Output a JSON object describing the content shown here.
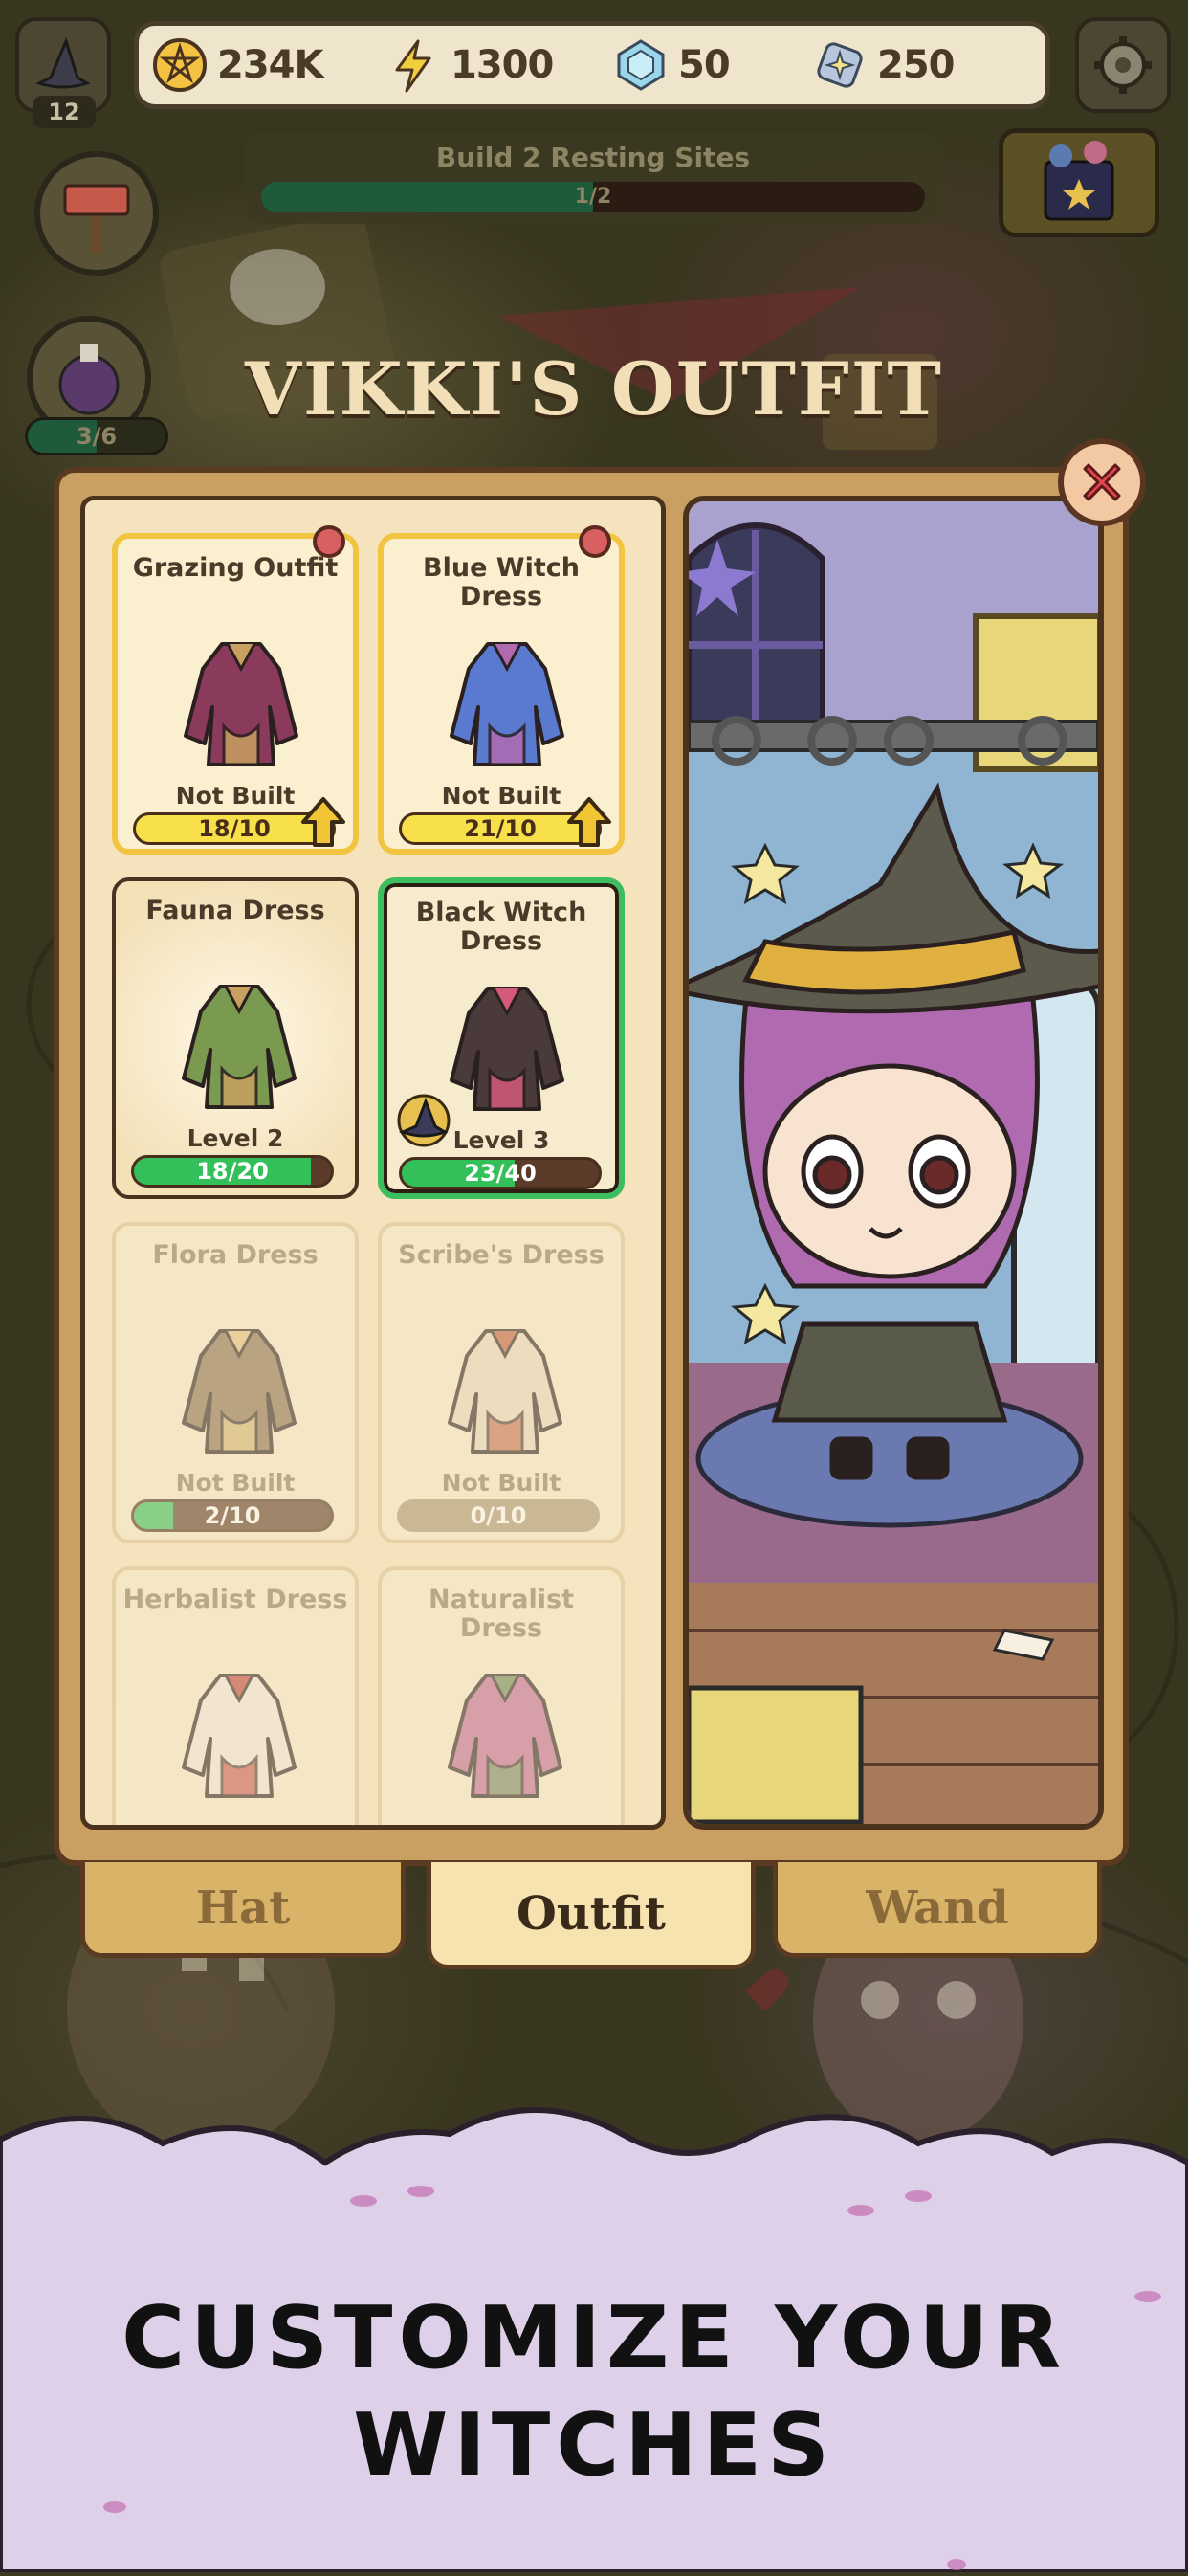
{
  "hud": {
    "gold": "234K",
    "energy": "1300",
    "gems": "50",
    "crystals": "250",
    "level": "12",
    "side_progress": "3/6",
    "side_progress_fraction": 0.5
  },
  "quest": {
    "title": "Build 2 Resting Sites",
    "progress": "1/2",
    "progress_fraction": 0.5
  },
  "panel": {
    "title": "VIKKI'S OUTFIT"
  },
  "outfits": [
    {
      "name": "Grazing Outfit",
      "status": "Not Built",
      "bar": "18/10",
      "fraction": 1.0,
      "state": "upgrade",
      "notify": true
    },
    {
      "name": "Blue Witch Dress",
      "status": "Not Built",
      "bar": "21/10",
      "fraction": 1.0,
      "state": "upgrade",
      "notify": true
    },
    {
      "name": "Fauna Dress",
      "status": "Level 2",
      "bar": "18/20",
      "fraction": 0.9,
      "state": "owned"
    },
    {
      "name": "Black Witch Dress",
      "status": "Level 3",
      "bar": "23/40",
      "fraction": 0.575,
      "state": "selected"
    },
    {
      "name": "Flora Dress",
      "status": "Not Built",
      "bar": "2/10",
      "fraction": 0.2,
      "state": "locked"
    },
    {
      "name": "Scribe's Dress",
      "status": "Not Built",
      "bar": "0/10",
      "fraction": 0.0,
      "state": "locked"
    },
    {
      "name": "Herbalist Dress",
      "state": "locked"
    },
    {
      "name": "Naturalist Dress",
      "state": "locked"
    }
  ],
  "tabs": {
    "hat": "Hat",
    "outfit": "Outfit",
    "wand": "Wand"
  },
  "promo": {
    "line1": "CUSTOMIZE YOUR",
    "line2": "WITCHES"
  },
  "colors": {
    "progress_green": "#33c05a",
    "upgrade_yellow": "#f7e04a",
    "selected_border": "#3cbd5e",
    "promo_bg": "#ddd0e8"
  }
}
